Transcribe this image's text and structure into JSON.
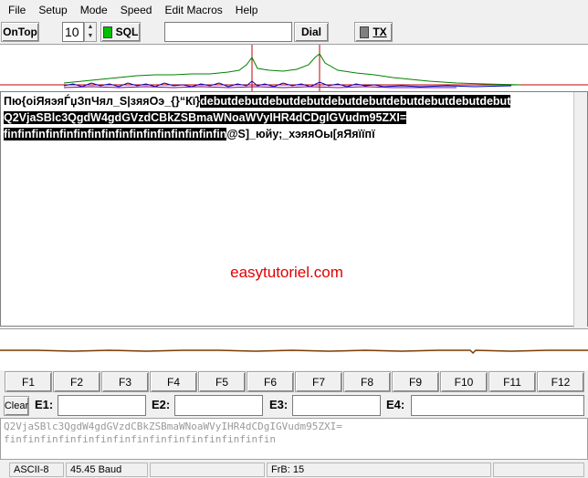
{
  "menu": [
    "File",
    "Setup",
    "Mode",
    "Speed",
    "Edit Macros",
    "Help"
  ],
  "toolbar": {
    "ontop_label": "OnTop",
    "squelch_value": "10",
    "sql_label": "SQL",
    "call_value": "",
    "dial_label": "Dial",
    "tx_label": "TX"
  },
  "colors": {
    "sql_led": "#00c000",
    "tx_led": "#808080",
    "highlight": "#000000",
    "watermark": "#e00000"
  },
  "rx": {
    "line1_plain": "Пю{oiЯяэяЃџЗп\u001fЧял_S|зяяОэ_{}“Кї}",
    "line1_hl": "debutdebutdebutdebutdebutdebutdebutdebutdebutdebut",
    "line2_hl": "Q2VjaSBlc3QgdW4gdGVzdCBkZSBmaWNoaWVyIHR4dCDgIGVudm95ZXI=",
    "line3_hl": "finfinfinfinfinfinfinfinfinfinfinfinfinfinfinfin",
    "line3_plain": "@S]_юйу;_хэяяОы[яЯяїїпї",
    "watermark": "easytutoriel.com"
  },
  "fkeys": [
    "F1",
    "F2",
    "F3",
    "F4",
    "F5",
    "F6",
    "F7",
    "F8",
    "F9",
    "F10",
    "F11",
    "F12"
  ],
  "emacros": {
    "clear_label": "Clear",
    "labels": [
      "E1:",
      "E2:",
      "E3:",
      "E4:"
    ],
    "values": [
      "",
      "",
      "",
      ""
    ]
  },
  "tx": {
    "line1": "Q2VjaSBlc3QgdW4gdGVzdCBkZSBmaWNoaWVyIHR4dCDgIGVudm95ZXI=",
    "line2": "finfinfinfinfinfinfinfinfinfinfinfinfinfinfin"
  },
  "status": {
    "charset": "ASCII-8",
    "baud": "45.45 Baud",
    "frb": "FrB: 15"
  }
}
